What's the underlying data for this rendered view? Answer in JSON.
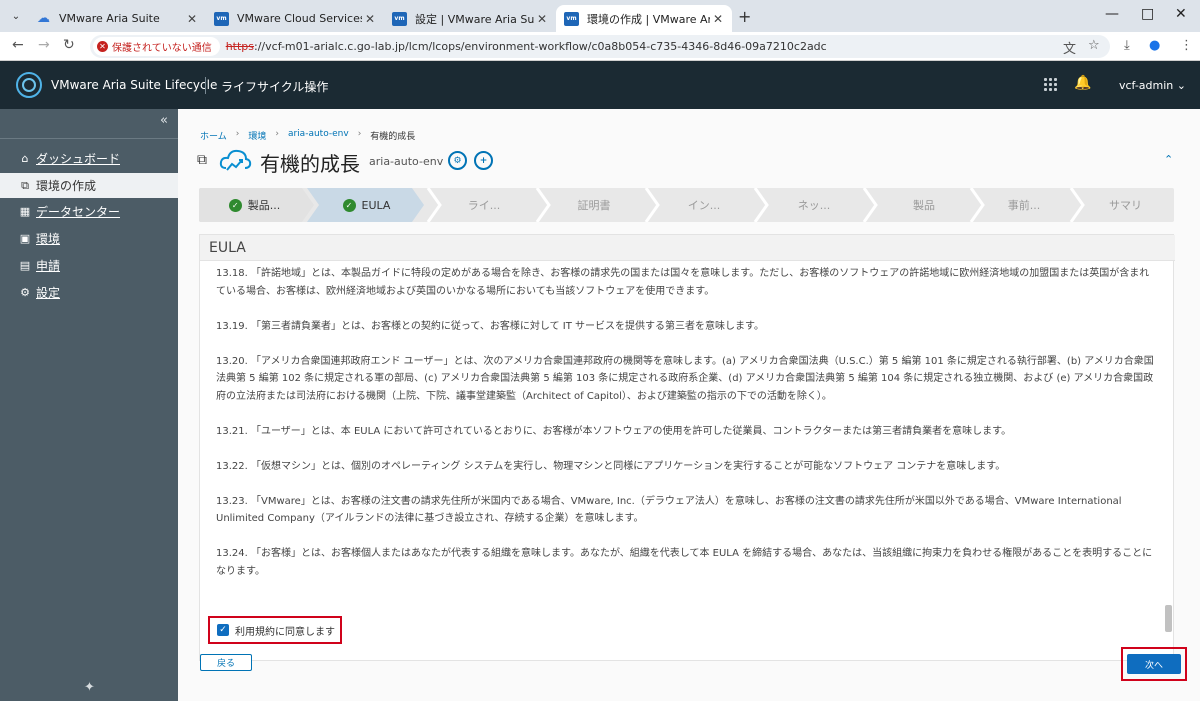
{
  "browser": {
    "tabs": [
      {
        "title": "VMware Aria Suite",
        "icon": "cloud-icon"
      },
      {
        "title": "VMware Cloud Services",
        "icon": "vmware-icon"
      },
      {
        "title": "設定 | VMware Aria Suite Lifecyc",
        "icon": "vmware-icon"
      },
      {
        "title": "環境の作成 | VMware Aria Suite",
        "icon": "vmware-icon",
        "active": true
      }
    ],
    "security_label": "保護されていない通信",
    "url_protocol": "https",
    "url_rest": "://vcf-m01-arialc.c.go-lab.jp/lcm/lcops/environment-workflow/c0a8b054-c735-4346-8d46-09a7210c2adc"
  },
  "header": {
    "app_name": "VMware Aria Suite Lifecycle",
    "section": "ライフサイクル操作",
    "user": "vcf-admin"
  },
  "sidebar": {
    "items": [
      {
        "label": "ダッシュボード",
        "icon": "home-icon",
        "underline": true
      },
      {
        "label": "環境の作成",
        "icon": "create-icon",
        "active": true
      },
      {
        "label": "データセンター",
        "icon": "datacenter-icon",
        "underline": true
      },
      {
        "label": "環境",
        "icon": "environment-icon",
        "underline": true
      },
      {
        "label": "申請",
        "icon": "request-icon",
        "underline": true
      },
      {
        "label": "設定",
        "icon": "settings-icon",
        "underline": true
      }
    ]
  },
  "breadcrumb": [
    "ホーム",
    "環境",
    "aria-auto-env",
    "有機的成長"
  ],
  "page": {
    "title": "有機的成長",
    "subtitle": "aria-auto-env"
  },
  "steps": [
    {
      "label": "製品...",
      "done": true
    },
    {
      "label": "EULA",
      "done": true,
      "current": true
    },
    {
      "label": "ライ..."
    },
    {
      "label": "証明書"
    },
    {
      "label": "イン..."
    },
    {
      "label": "ネッ..."
    },
    {
      "label": "製品"
    },
    {
      "label": "事前..."
    },
    {
      "label": "サマリ"
    }
  ],
  "eula": {
    "heading": "EULA",
    "paragraphs": [
      "13.18. 「許諾地域」とは、本製品ガイドに特段の定めがある場合を除き、お客様の請求先の国または国々を意味します。ただし、お客様のソフトウェアの許諾地域に欧州経済地域の加盟国または英国が含まれている場合、お客様は、欧州経済地域および英国のいかなる場所においても当該ソフトウェアを使用できます。",
      "13.19. 「第三者請負業者」とは、お客様との契約に従って、お客様に対して IT サービスを提供する第三者を意味します。",
      "13.20. 「アメリカ合衆国連邦政府エンド ユーザー」とは、次のアメリカ合衆国連邦政府の機関等を意味します。(a) アメリカ合衆国法典（U.S.C.）第 5 編第 101 条に規定される執行部署、(b) アメリカ合衆国法典第 5 編第 102 条に規定される軍の部局、(c) アメリカ合衆国法典第 5 編第 103 条に規定される政府系企業、(d) アメリカ合衆国法典第 5 編第 104 条に規定される独立機関、および (e) アメリカ合衆国政府の立法府または司法府における機関（上院、下院、議事堂建築監（Architect of Capitol）、および建築監の指示の下での活動を除く）。",
      "13.21. 「ユーザー」とは、本 EULA において許可されているとおりに、お客様が本ソフトウェアの使用を許可した従業員、コントラクターまたは第三者請負業者を意味します。",
      "13.22. 「仮想マシン」とは、個別のオペレーティング システムを実行し、物理マシンと同様にアプリケーションを実行することが可能なソフトウェア コンテナを意味します。",
      "13.23. 「VMware」とは、お客様の注文書の請求先住所が米国内である場合、VMware, Inc.（デラウェア法人）を意味し、お客様の注文書の請求先住所が米国以外である場合、VMware International Unlimited Company（アイルランドの法律に基づき設立され、存続する企業）を意味します。",
      "13.24. 「お客様」とは、お客様個人またはあなたが代表する組織を意味します。あなたが、組織を代表して本 EULA を締結する場合、あなたは、当該組織に拘束力を負わせる権限があることを表明することになります。"
    ],
    "agree_label": "利用規約に同意します",
    "agree_checked": true
  },
  "buttons": {
    "back": "戻る",
    "next": "次へ"
  },
  "colors": {
    "header_bg": "#1b2a33",
    "sidebar_bg": "#4c5c66",
    "primary": "#0f6dbf",
    "highlight_border": "#d0021b",
    "step_done": "#2f8a2f"
  }
}
